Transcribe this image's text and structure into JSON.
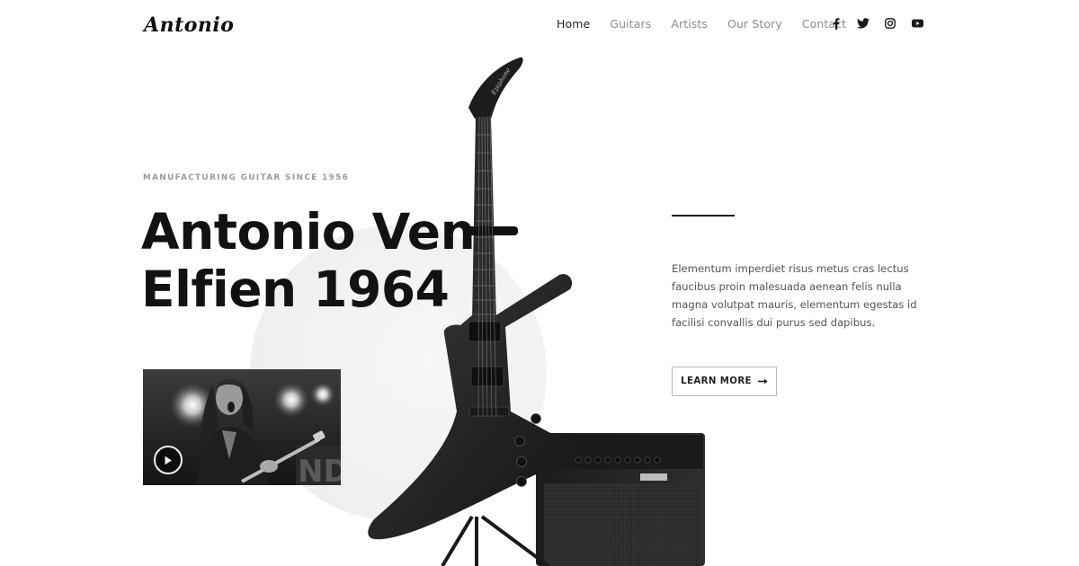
{
  "brand": {
    "logo_text": "Antonio"
  },
  "nav": {
    "items": [
      {
        "label": "Home",
        "active": true
      },
      {
        "label": "Guitars"
      },
      {
        "label": "Artists"
      },
      {
        "label": "Our Story"
      },
      {
        "label": "Contact"
      }
    ]
  },
  "socials": [
    "facebook-icon",
    "twitter-icon",
    "instagram-icon",
    "youtube-icon"
  ],
  "hero": {
    "eyebrow": "MANUFACTURING GUITAR SINCE 1956",
    "headline_line1": "Antonio Ven",
    "headline_line2": "Elfien 1964",
    "description": "Elementum imperdiet risus metus cras lectus faucibus proin malesuada aenean felis nulla magna volutpat mauris, elementum egestas id facilisi convallis dui purus sed dapibus.",
    "cta_label": "LEARN MORE"
  },
  "colors": {
    "text": "#121212",
    "muted": "#8b8b8b",
    "accent": "#1a1a1a",
    "background": "#ffffff"
  }
}
